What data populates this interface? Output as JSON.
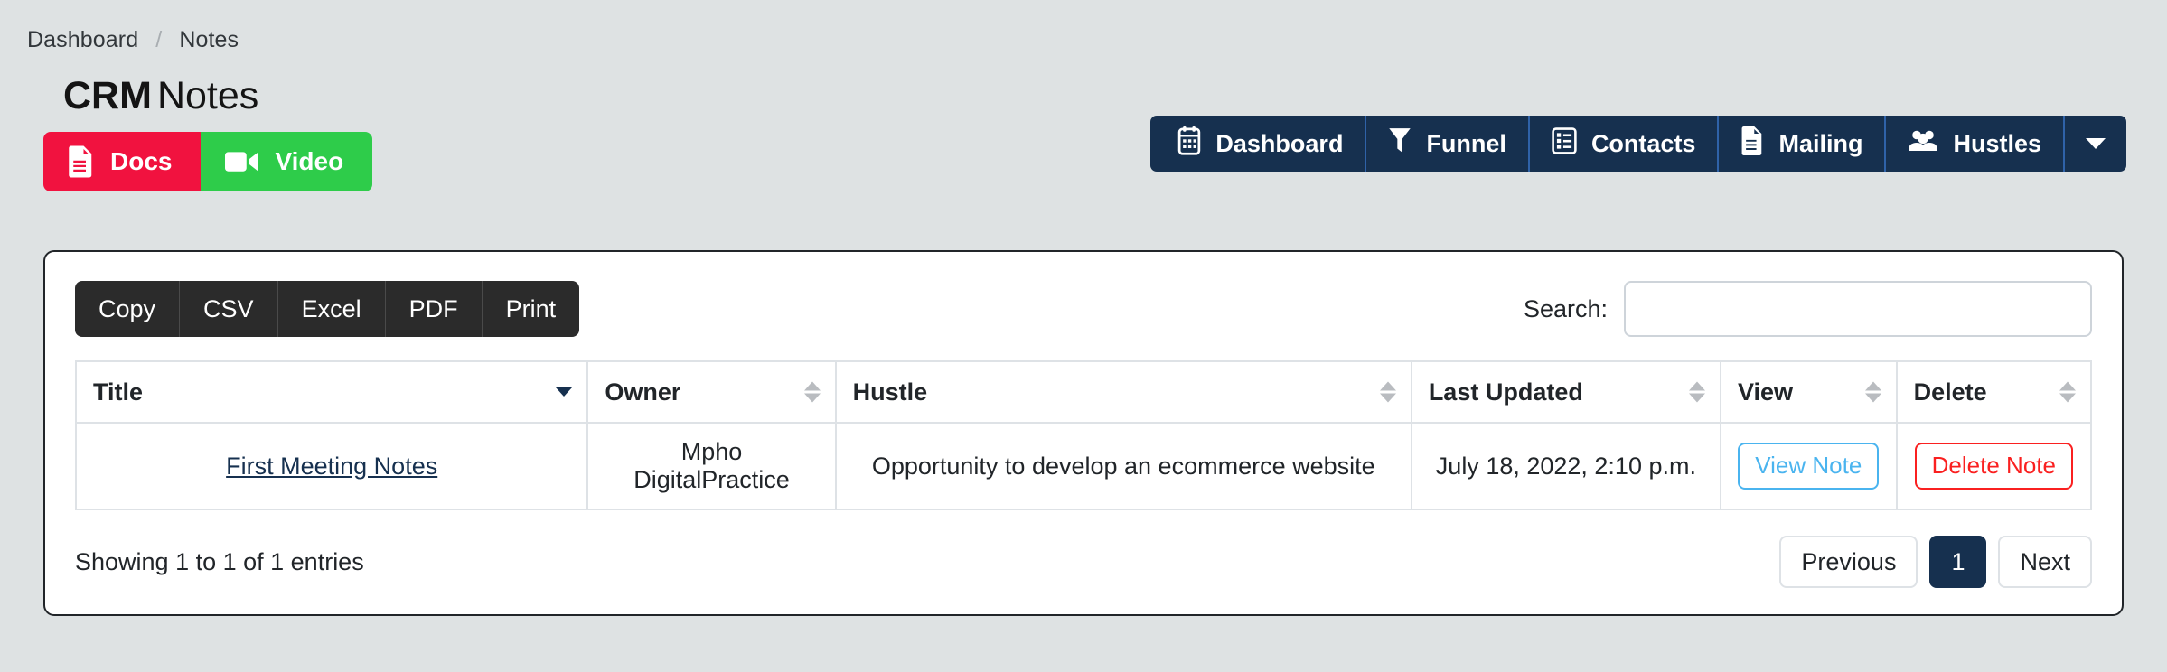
{
  "breadcrumb": {
    "items": [
      "Dashboard",
      "Notes"
    ],
    "separator": "/"
  },
  "page_title": {
    "strong": "CRM",
    "light": "Notes"
  },
  "media_buttons": [
    {
      "label": "Docs",
      "icon": "file-lines-icon",
      "color": "#f1123f"
    },
    {
      "label": "Video",
      "icon": "video-camera-icon",
      "color": "#2ecc4a"
    }
  ],
  "topnav": {
    "background": "#16304f",
    "divider_color": "#2f62a8",
    "items": [
      {
        "label": "Dashboard",
        "icon": "calendar-icon"
      },
      {
        "label": "Funnel",
        "icon": "filter-icon"
      },
      {
        "label": "Contacts",
        "icon": "list-icon"
      },
      {
        "label": "Mailing",
        "icon": "document-icon"
      },
      {
        "label": "Hustles",
        "icon": "users-icon"
      }
    ],
    "dropdown_icon": "chevron-down-icon"
  },
  "datatable": {
    "export_buttons": [
      "Copy",
      "CSV",
      "Excel",
      "PDF",
      "Print"
    ],
    "search": {
      "label": "Search:",
      "value": "",
      "placeholder": ""
    },
    "columns": [
      {
        "label": "Title",
        "sort": "desc"
      },
      {
        "label": "Owner",
        "sort": "none"
      },
      {
        "label": "Hustle",
        "sort": "none"
      },
      {
        "label": "Last Updated",
        "sort": "none"
      },
      {
        "label": "View",
        "sort": "none"
      },
      {
        "label": "Delete",
        "sort": "none"
      }
    ],
    "rows": [
      {
        "title": "First Meeting Notes",
        "owner": "Mpho DigitalPractice",
        "hustle": "Opportunity to develop an ecommerce website",
        "last_updated": "July 18, 2022, 2:10 p.m.",
        "view_label": "View Note",
        "delete_label": "Delete Note"
      }
    ],
    "info": "Showing 1 to 1 of 1 entries",
    "pagination": {
      "previous": "Previous",
      "pages": [
        "1"
      ],
      "next": "Next",
      "active_page": "1"
    }
  }
}
